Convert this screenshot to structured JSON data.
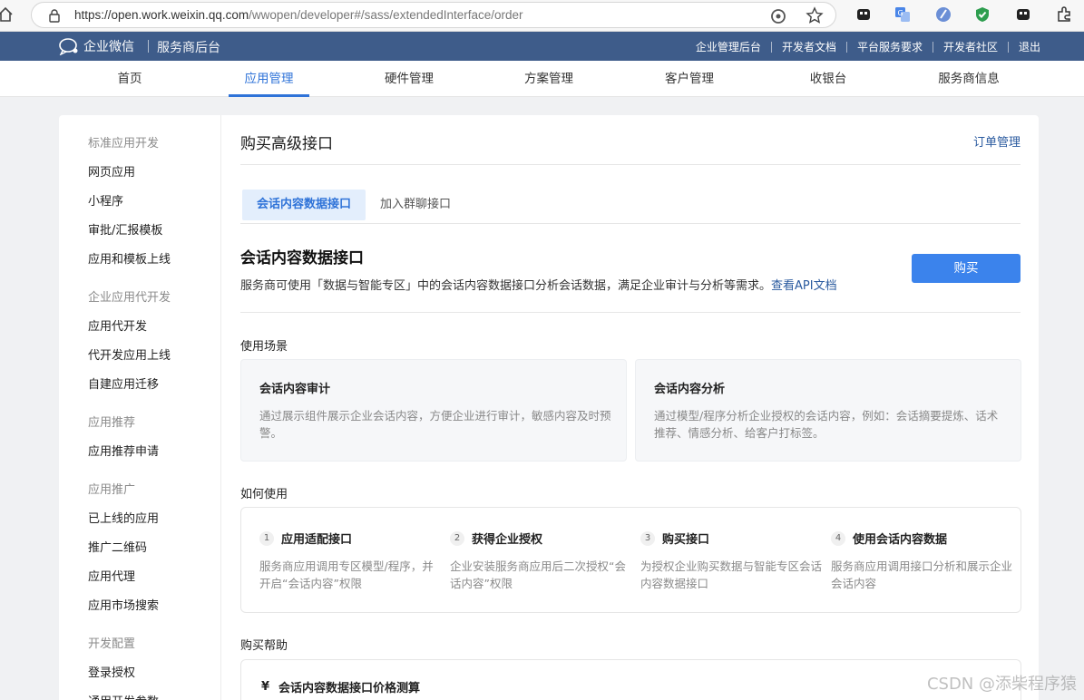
{
  "browser": {
    "url_main": "https://open.work.weixin.qq.com",
    "url_rest": "/wwopen/developer#/sass/extendedInterface/order"
  },
  "topnav": {
    "logo": "企业微信",
    "sub": "服务商后台",
    "links": [
      "企业管理后台",
      "开发者文档",
      "平台服务要求",
      "开发者社区",
      "退出"
    ]
  },
  "mainnav": [
    "首页",
    "应用管理",
    "硬件管理",
    "方案管理",
    "客户管理",
    "收银台",
    "服务商信息"
  ],
  "sidebar": {
    "groups": [
      {
        "title": "标准应用开发",
        "items": [
          "网页应用",
          "小程序",
          "审批/汇报模板",
          "应用和模板上线"
        ]
      },
      {
        "title": "企业应用代开发",
        "items": [
          "应用代开发",
          "代开发应用上线",
          "自建应用迁移"
        ]
      },
      {
        "title": "应用推荐",
        "items": [
          "应用推荐申请"
        ]
      },
      {
        "title": "应用推广",
        "items": [
          "已上线的应用",
          "推广二维码",
          "应用代理",
          "应用市场搜索"
        ]
      },
      {
        "title": "开发配置",
        "items": [
          "登录授权",
          "通用开发参数"
        ]
      }
    ]
  },
  "main": {
    "title": "购买高级接口",
    "order_link": "订单管理",
    "tabs": [
      "会话内容数据接口",
      "加入群聊接口"
    ],
    "section_title": "会话内容数据接口",
    "desc": "服务商可使用「数据与智能专区」中的会话内容数据接口分析会话数据，满足企业审计与分析等需求。",
    "desc_link": "查看API文档",
    "buy_label": "购买",
    "scenes_label": "使用场景",
    "scenes": [
      {
        "title": "会话内容审计",
        "text": "通过展示组件展示企业会话内容，方便企业进行审计，敏感内容及时预警。"
      },
      {
        "title": "会话内容分析",
        "text": "通过模型/程序分析企业授权的会话内容，例如：会话摘要提炼、话术推荐、情感分析、给客户打标签。"
      }
    ],
    "howto_label": "如何使用",
    "steps": [
      {
        "num": "1",
        "title": "应用适配接口",
        "text": "服务商应用调用专区模型/程序，并开启“会话内容”权限"
      },
      {
        "num": "2",
        "title": "获得企业授权",
        "text": "企业安装服务商应用后二次授权“会话内容”权限"
      },
      {
        "num": "3",
        "title": "购买接口",
        "text": "为授权企业购买数据与智能专区会话内容数据接口"
      },
      {
        "num": "4",
        "title": "使用会话内容数据",
        "text": "服务商应用调用接口分析和展示企业会话内容"
      }
    ],
    "help_label": "购买帮助",
    "help_item": "会话内容数据接口价格测算",
    "help_icon": "¥"
  },
  "watermark": "CSDN @添柴程序猿",
  "colors": {
    "brand": "#3e5c8a",
    "accent": "#2f73d8",
    "button": "#3b83ec"
  }
}
